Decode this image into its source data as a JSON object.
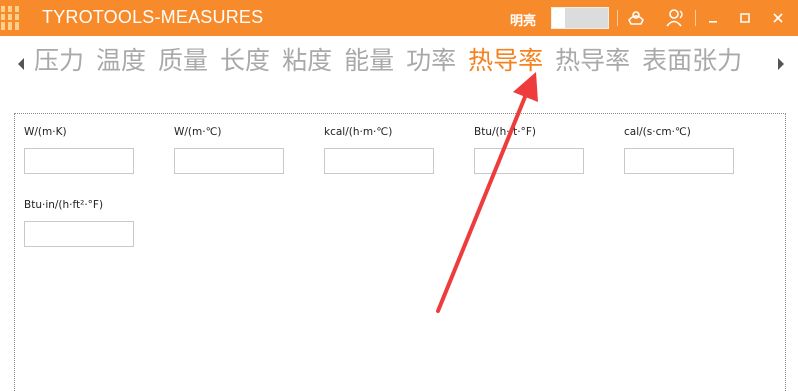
{
  "window": {
    "title": "TYROTOOLS-MEASURES",
    "theme_label": "明亮",
    "accent_color": "#f78b2b",
    "buttons": [
      "skin-icon",
      "user-icon",
      "minimize-icon",
      "maximize-icon",
      "close-icon"
    ]
  },
  "tabs": {
    "items": [
      "压力",
      "温度",
      "质量",
      "长度",
      "粘度",
      "能量",
      "功率",
      "热导率",
      "热导率",
      "表面张力"
    ],
    "active_index": 7,
    "active_color": "#f5821f",
    "inactive_color": "#a9a9a9"
  },
  "fields": [
    {
      "unit": "W/(m·K)",
      "value": ""
    },
    {
      "unit": "W/(m·℃)",
      "value": ""
    },
    {
      "unit": "kcal/(h·m·℃)",
      "value": ""
    },
    {
      "unit": "Btu/(h·ft·°F)",
      "value": ""
    },
    {
      "unit": "cal/(s·cm·℃)",
      "value": ""
    },
    {
      "unit": "Btu·in/(h·ft²·°F)",
      "value": ""
    }
  ],
  "annotation": {
    "type": "red-arrow",
    "color": "#ee3b3b"
  }
}
